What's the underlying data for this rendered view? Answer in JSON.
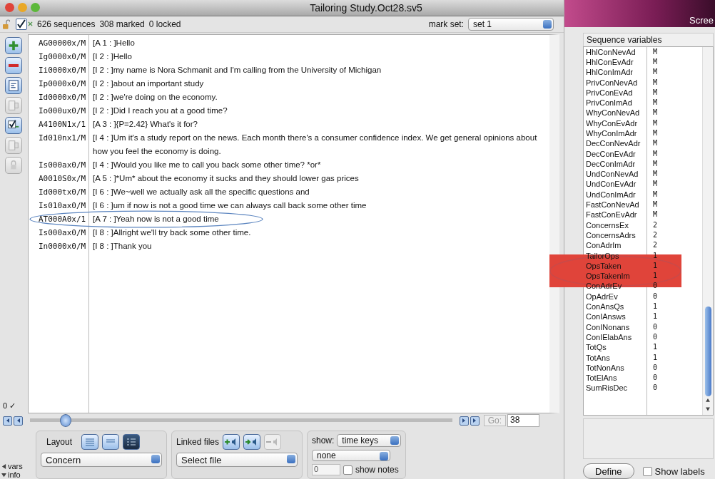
{
  "window": {
    "title": "Tailoring Study.Oct28.sv5"
  },
  "toolbar": {
    "locked": false,
    "marked_checked": true,
    "sequences": "626 sequences",
    "marked": "308 marked",
    "locked_count": "0 locked",
    "mark_set_label": "mark set:",
    "mark_set": "set 1"
  },
  "left_tools": [
    {
      "kind": "add",
      "disabled": false
    },
    {
      "kind": "remove",
      "disabled": false
    },
    {
      "kind": "list",
      "disabled": false
    },
    {
      "kind": "doc",
      "disabled": true
    },
    {
      "kind": "check",
      "disabled": false
    },
    {
      "kind": "doc",
      "disabled": true
    },
    {
      "kind": "lock",
      "disabled": true
    }
  ],
  "rows": [
    {
      "code": "AG00000x/M",
      "text": "[A 1 : ]Hello",
      "circled": false
    },
    {
      "code": "Ig0000x0/M",
      "text": "[I 2 : ]Hello",
      "circled": false
    },
    {
      "code": "Ii0000x0/M",
      "text": "[I 2 : ]my name is Nora Schmanit and I'm calling from the University of Michigan",
      "circled": false
    },
    {
      "code": "Ip0000x0/M",
      "text": "[I 2 : ]about an important study",
      "circled": false
    },
    {
      "code": "Id0000x0/M",
      "text": "[I 2 : ]we're doing on the economy.",
      "circled": false
    },
    {
      "code": "Io000ux0/M",
      "text": "[I 2 : ]Did I reach you at a good time?",
      "circled": false
    },
    {
      "code": "A4100N1x/1",
      "text": "[A 3 : ]{P=2.42} What's it for?",
      "circled": false
    },
    {
      "code": "Id010nx1/M",
      "text": "[I 4 : ]Um it's a study report on the news. Each month there's a consumer confidence index. We get general opinions about how you feel the economy is doing.",
      "circled": false
    },
    {
      "code": "Is000ax0/M",
      "text": "[I 4 : ]Would you like me to call you back some other time? *or*",
      "circled": false
    },
    {
      "code": "A0010S0x/M",
      "text": "[A 5 : ]*Um* about the economy it sucks and they should lower gas prices",
      "circled": false
    },
    {
      "code": "Id000tx0/M",
      "text": "[I 6 : ]We~well we actually ask all the specific questions and",
      "circled": false
    },
    {
      "code": "Is010ax0/M",
      "text": "[I 6 : ]um if now is not a good time we can always call back some other time",
      "circled": false
    },
    {
      "code": "AT000A0x/1",
      "text": "[A 7 : ]Yeah now is not a good time",
      "circled": true
    },
    {
      "code": "Is000ax0/M",
      "text": "[I 8 : ]Allright we'll try back some other time.",
      "circled": false
    },
    {
      "code": "In0000x0/M",
      "text": "[I 8 : ]Thank you",
      "circled": false
    }
  ],
  "row_count": "0 ✓",
  "slider": {
    "level": 0.07
  },
  "go": {
    "label": "Go:",
    "value": "38"
  },
  "layout": {
    "label": "Layout",
    "buttons": [
      {
        "kind": "grid",
        "selected": false
      },
      {
        "kind": "columns",
        "selected": false
      },
      {
        "kind": "outline",
        "selected": true
      }
    ],
    "select": "Concern"
  },
  "linked_files": {
    "label": "Linked files",
    "buttons": [
      {
        "kind": "add",
        "disabled": false
      },
      {
        "kind": "link",
        "disabled": false
      },
      {
        "kind": "remove",
        "disabled": true
      }
    ],
    "select": "Select file"
  },
  "show": {
    "label": "show:",
    "select": "time keys",
    "second_select": "none",
    "field": "0",
    "notes_label": "show notes",
    "notes_checked": false
  },
  "side_toggles": [
    {
      "label": "vars",
      "expanded": false
    },
    {
      "label": "info",
      "expanded": true
    }
  ],
  "screen_panel": {
    "title": "Scree",
    "header": "Sequence variables",
    "variables": [
      {
        "name": "HhlConNevAd",
        "value": "M",
        "circled": false
      },
      {
        "name": "HhlConEvAdr",
        "value": "M",
        "circled": false
      },
      {
        "name": "HhlConImAdr",
        "value": "M",
        "circled": false
      },
      {
        "name": "PrivConNevAd",
        "value": "M",
        "circled": false
      },
      {
        "name": "PrivConEvAd",
        "value": "M",
        "circled": false
      },
      {
        "name": "PrivConImAd",
        "value": "M",
        "circled": false
      },
      {
        "name": "WhyConNevAd",
        "value": "M",
        "circled": false
      },
      {
        "name": "WhyConEvAdr",
        "value": "M",
        "circled": false
      },
      {
        "name": "WhyConImAdr",
        "value": "M",
        "circled": false
      },
      {
        "name": "DecConNevAdr",
        "value": "M",
        "circled": false
      },
      {
        "name": "DecConEvAdr",
        "value": "M",
        "circled": false
      },
      {
        "name": "DecConImAdr",
        "value": "M",
        "circled": false
      },
      {
        "name": "UndConNevAd",
        "value": "M",
        "circled": false
      },
      {
        "name": "UndConEvAdr",
        "value": "M",
        "circled": false
      },
      {
        "name": "UndConImAdr",
        "value": "M",
        "circled": false
      },
      {
        "name": "FastConNevAd",
        "value": "M",
        "circled": false
      },
      {
        "name": "FastConEvAdr",
        "value": "M",
        "circled": false
      },
      {
        "name": "ConcernsEx",
        "value": "2",
        "circled": false
      },
      {
        "name": "ConcernsAdrs",
        "value": "2",
        "circled": false
      },
      {
        "name": "ConAdrIm",
        "value": "2",
        "circled": false
      },
      {
        "name": "TailorOps",
        "value": "1",
        "circled": false
      },
      {
        "name": "OpsTaken",
        "value": "1",
        "circled": true
      },
      {
        "name": "OpsTakenIm",
        "value": "1",
        "circled": true
      },
      {
        "name": "ConAdrEv",
        "value": "0",
        "circled": false
      },
      {
        "name": "OpAdrEv",
        "value": "0",
        "circled": false
      },
      {
        "name": "ConAnsQs",
        "value": "1",
        "circled": false
      },
      {
        "name": "ConIAnsws",
        "value": "1",
        "circled": false
      },
      {
        "name": "ConINonans",
        "value": "0",
        "circled": false
      },
      {
        "name": "ConIElabAns",
        "value": "0",
        "circled": false
      },
      {
        "name": "TotQs",
        "value": "1",
        "circled": false
      },
      {
        "name": "TotAns",
        "value": "1",
        "circled": false
      },
      {
        "name": "TotNonAns",
        "value": "0",
        "circled": false
      },
      {
        "name": "TotElAns",
        "value": "0",
        "circled": false
      },
      {
        "name": "SumRisDec",
        "value": "0",
        "circled": false
      }
    ],
    "define_button": "Define",
    "show_labels": "Show labels",
    "show_labels_checked": false
  }
}
